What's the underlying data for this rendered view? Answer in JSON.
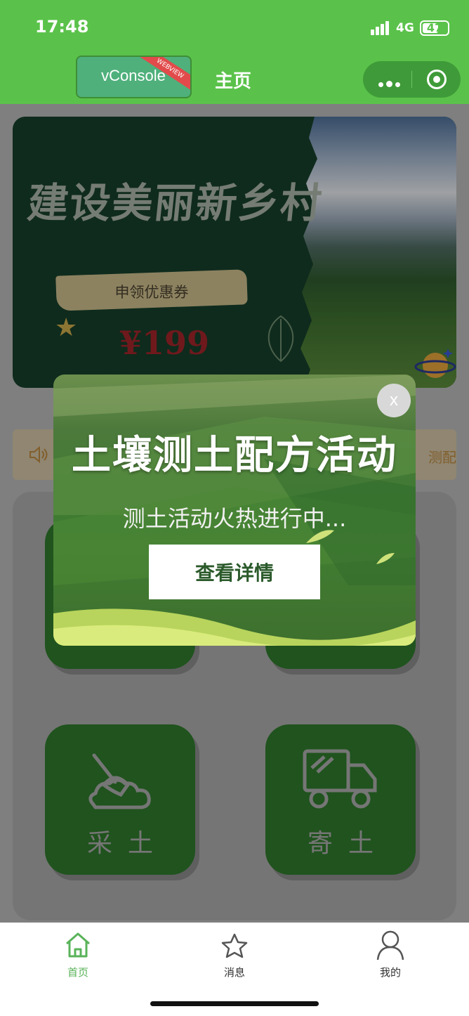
{
  "status_bar": {
    "time": "17:48",
    "network": "4G",
    "battery": "47"
  },
  "nav": {
    "vconsole_label": "vConsole",
    "vconsole_badge": "WEBVIEW",
    "title": "主页",
    "capsule_more_icon": "more-dots-icon",
    "capsule_close_icon": "target-circle-icon"
  },
  "banner": {
    "title": "建设美丽新乡村",
    "coupon_label": "申领优惠券",
    "price": "¥199"
  },
  "notice": {
    "icon": "speaker-icon",
    "text": "测配方"
  },
  "tiles": [
    {
      "label": "",
      "icon": "tile-icon"
    },
    {
      "label": "",
      "icon": "tile-icon"
    },
    {
      "label": "采土",
      "icon": "shovel-soil-icon"
    },
    {
      "label": "寄土",
      "icon": "delivery-truck-icon"
    }
  ],
  "popup": {
    "title": "土壤测土配方活动",
    "subtitle": "测土活动火热进行中...",
    "button_label": "查看详情",
    "close_label": "x"
  },
  "tabbar": {
    "items": [
      {
        "label": "首页",
        "icon": "home-icon",
        "active": true
      },
      {
        "label": "消息",
        "icon": "star-icon",
        "active": false
      },
      {
        "label": "我的",
        "icon": "user-icon",
        "active": false
      }
    ]
  },
  "colors": {
    "nav_green": "#5ac24a",
    "tile_green": "#2e782c",
    "active_tab": "#5ab35a",
    "price_red": "#a0242a"
  }
}
